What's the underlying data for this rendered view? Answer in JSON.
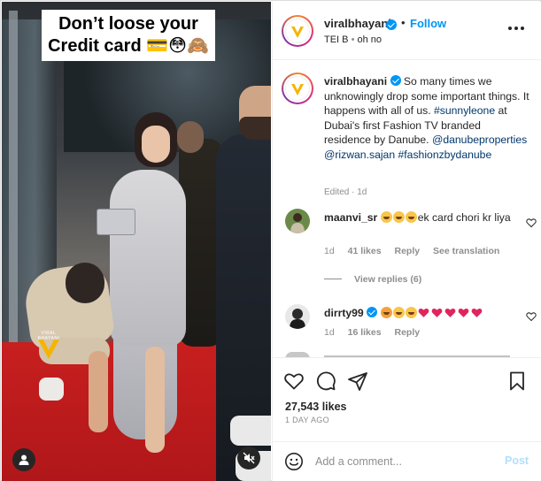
{
  "media": {
    "caption_line1": "Don’t loose your",
    "caption_line2": "Credit card 💳😳🙈",
    "watermark_text": "VIRAL BHAYANI"
  },
  "header": {
    "username": "viralbhayani",
    "dot": "•",
    "follow_label": "Follow",
    "location": "TEI B",
    "separator": "•",
    "audio": "oh no"
  },
  "caption": {
    "username": "viralbhayani",
    "text1": "So many times we unknowingly drop some important things. It happens with all of us. ",
    "hashtag1": "#sunnyleone",
    "text2": " at Dubai's first Fashion TV branded residence by Danube. ",
    "mention1": "@danubeproperties",
    "mention2": "@rizwan.sajan",
    "hashtag2": "#fashionzbydanube",
    "meta": "Edited · 1d"
  },
  "comments": [
    {
      "username": "maanvi_sr",
      "text": "ek card chori kr liya",
      "time": "1d",
      "likes": "41 likes",
      "reply": "Reply",
      "see_translation": "See translation",
      "view_replies": "View replies (6)"
    },
    {
      "username": "dirrty99",
      "time": "1d",
      "likes": "16 likes",
      "reply": "Reply"
    }
  ],
  "actions": {
    "like_count": "27,543 likes",
    "posted": "1 DAY AGO"
  },
  "add_comment": {
    "placeholder": "Add a comment...",
    "post_label": "Post"
  },
  "colors": {
    "link_blue": "#0095f6",
    "hashtag": "#00376b",
    "muted": "#8e8e8e",
    "post_disabled": "#b2dffc"
  }
}
